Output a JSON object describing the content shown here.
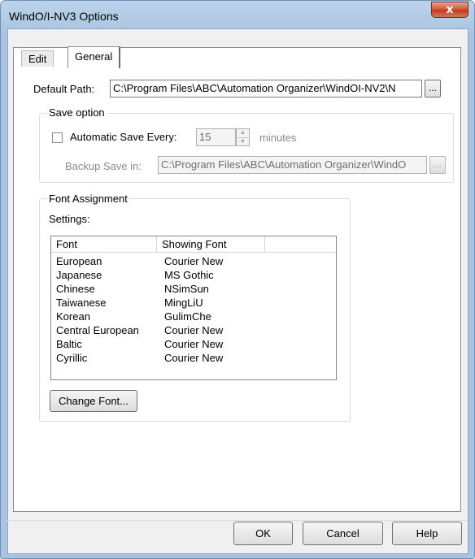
{
  "window": {
    "title": "WindO/I-NV3 Options",
    "close_glyph": "x"
  },
  "tabs": [
    {
      "label": "Edit",
      "selected": false
    },
    {
      "label": "General",
      "selected": true
    }
  ],
  "default_path": {
    "label": "Default Path:",
    "value": "C:\\Program Files\\ABC\\Automation Organizer\\WindOI-NV2\\N",
    "browse_label": "..."
  },
  "save_option": {
    "group_title": "Save option",
    "auto_save_label": "Automatic Save Every:",
    "auto_save_checked": false,
    "minutes_value": "15",
    "minutes_unit": "minutes",
    "backup_label": "Backup Save in:",
    "backup_value": "C:\\Program Files\\ABC\\Automation Organizer\\WindO",
    "backup_browse_label": "..."
  },
  "font_assignment": {
    "group_title": "Font Assignment",
    "settings_label": "Settings:",
    "columns": [
      "Font",
      "Showing Font",
      ""
    ],
    "rows": [
      {
        "font": "European",
        "showing": "Courier New"
      },
      {
        "font": "Japanese",
        "showing": "MS Gothic"
      },
      {
        "font": "Chinese",
        "showing": "NSimSun"
      },
      {
        "font": "Taiwanese",
        "showing": "MingLiU"
      },
      {
        "font": "Korean",
        "showing": "GulimChe"
      },
      {
        "font": "Central European",
        "showing": "Courier New"
      },
      {
        "font": "Baltic",
        "showing": "Courier New"
      },
      {
        "font": "Cyrillic",
        "showing": "Courier New"
      }
    ],
    "change_font_label": "Change Font..."
  },
  "footer": {
    "ok_label": "OK",
    "cancel_label": "Cancel",
    "help_label": "Help"
  },
  "colors": {
    "title_bar": "#a9c4e2",
    "close_button": "#c0391b",
    "dialog_bg": "#f0f0f0",
    "panel_bg": "#ffffff"
  }
}
